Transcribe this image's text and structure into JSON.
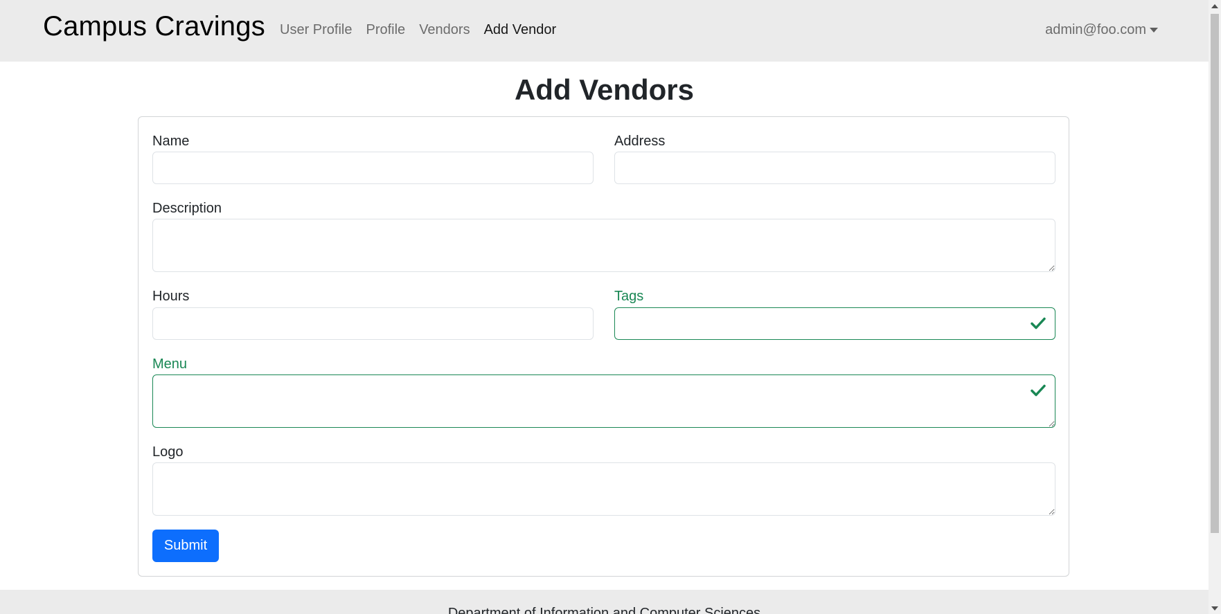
{
  "navbar": {
    "brand": "Campus Cravings",
    "links": [
      {
        "label": "User Profile",
        "active": false
      },
      {
        "label": "Profile",
        "active": false
      },
      {
        "label": "Vendors",
        "active": false
      },
      {
        "label": "Add Vendor",
        "active": true
      }
    ],
    "user_menu": "admin@foo.com"
  },
  "page": {
    "title": "Add Vendors"
  },
  "form": {
    "name": {
      "label": "Name",
      "value": ""
    },
    "address": {
      "label": "Address",
      "value": ""
    },
    "description": {
      "label": "Description",
      "value": ""
    },
    "hours": {
      "label": "Hours",
      "value": ""
    },
    "tags": {
      "label": "Tags",
      "value": "",
      "state": "valid"
    },
    "menu": {
      "label": "Menu",
      "value": "",
      "state": "valid"
    },
    "logo": {
      "label": "Logo",
      "value": ""
    },
    "submit_label": "Submit"
  },
  "footer": {
    "text": "Department of Information and Computer Sciences"
  },
  "colors": {
    "navbar_bg": "#ebebeb",
    "primary": "#0d6efd",
    "valid": "#198754"
  },
  "icons": {
    "valid_indicator": "check-icon",
    "user_menu_toggle": "caret-down-icon",
    "textarea_resize": "resize-grip-icon"
  }
}
